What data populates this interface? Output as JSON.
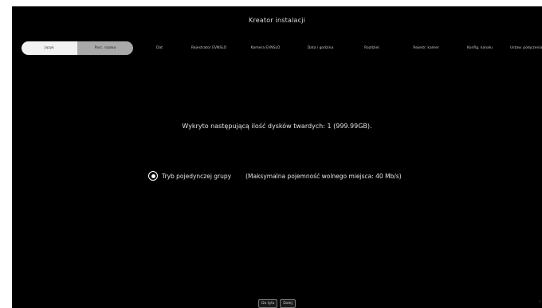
{
  "window": {
    "title": "Kreator instalacji"
  },
  "tabs": [
    {
      "label": "Język"
    },
    {
      "label": "Parc. nazwa"
    },
    {
      "label": "Dat"
    },
    {
      "label": "Rejestrator EVNSLO"
    },
    {
      "label": "Kamera EVNSLO"
    },
    {
      "label": "Data i godzina"
    },
    {
      "label": "Rozdziel."
    },
    {
      "label": "Rejestr. kamer"
    },
    {
      "label": "Konfig. kanału"
    },
    {
      "label": "Ustaw. połączenia"
    }
  ],
  "content": {
    "message": "Wykryto następującą ilość dysków twardych: 1 (999.99GB).",
    "option_label": "Tryb pojedynczej grupy",
    "option_description": "(Maksymalna pojemność wolnego miejsca: 40 Mb/s)"
  },
  "buttons": {
    "back": "Do tyłu",
    "next": "Dalej"
  },
  "colors": {
    "background": "#000000",
    "active_tab": "#f2f2f2",
    "secondary_tab": "#a9a9a9"
  }
}
